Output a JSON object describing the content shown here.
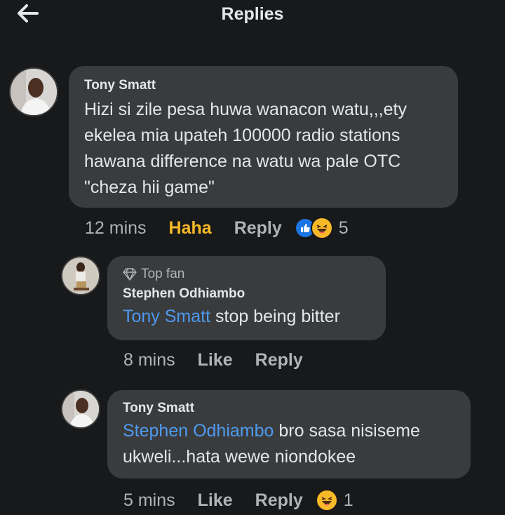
{
  "header": {
    "title": "Replies",
    "back_icon": "back-arrow-icon"
  },
  "colors": {
    "background": "#18191a",
    "bubble": "#3a3b3c",
    "mention": "#4d9af0",
    "haha": "#f7b928",
    "like_blue": "#1b74e4"
  },
  "comments": [
    {
      "author": "Tony Smatt",
      "lines": [
        "Hizi si zile pesa huwa wanacon watu,,,ety",
        "ekelea mia upateh 100000 radio stations",
        "hawana difference na watu wa pale OTC",
        "\"cheza hii game\""
      ],
      "time": "12 mins",
      "reaction_label": "Haha",
      "reply_label": "Reply",
      "reaction_count": "5"
    },
    {
      "badge": "Top fan",
      "author": "Stephen Odhiambo",
      "mention": "Tony Smatt",
      "text": " stop being bitter",
      "time": "8 mins",
      "like_label": "Like",
      "reply_label": "Reply"
    },
    {
      "author": "Tony Smatt",
      "mention": "Stephen Odhiambo",
      "text_line1": " bro sasa nisiseme",
      "text_line2": "ukweli...hata wewe niondokee",
      "time": "5 mins",
      "like_label": "Like",
      "reply_label": "Reply",
      "reaction_count": "1"
    }
  ]
}
